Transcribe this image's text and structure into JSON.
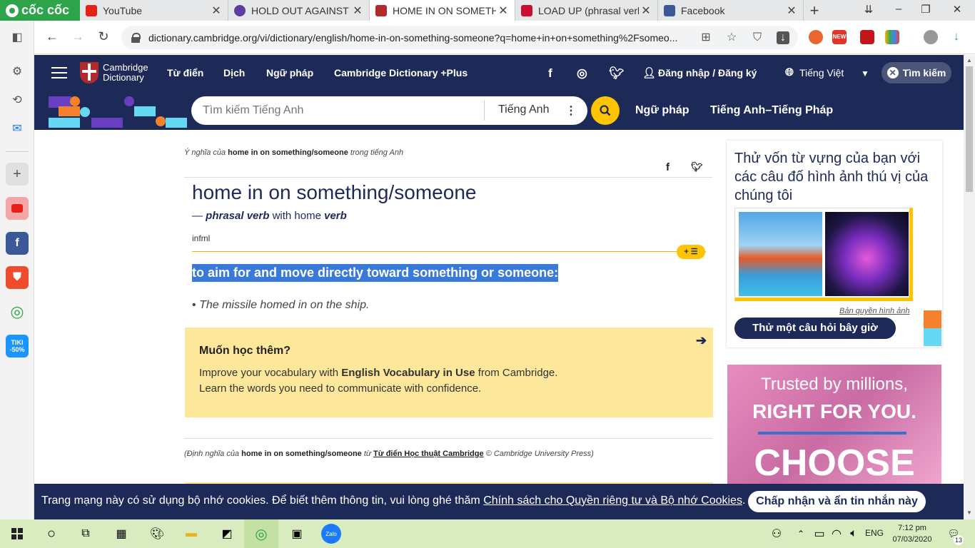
{
  "browser": {
    "brand": "cốc cốc",
    "tabs": [
      {
        "label": "YouTube",
        "color": "#e62117"
      },
      {
        "label": "HOLD OUT AGAINST - D",
        "color": "#5a3ea0"
      },
      {
        "label": "HOME IN ON SOMETHI",
        "color": "#b4292b"
      },
      {
        "label": "LOAD UP (phrasal verb)",
        "color": "#c8102e"
      },
      {
        "label": "Facebook",
        "color": "#3b5998"
      }
    ],
    "new_tab": "+",
    "url": "dictionary.cambridge.org/vi/dictionary/english/home-in-on-something-someone?q=home+in+on+something%2Fsomeo...",
    "ext_new_label": "NEW"
  },
  "header": {
    "logo_line1": "Cambridge",
    "logo_line2": "Dictionary",
    "nav": [
      "Từ điển",
      "Dịch",
      "Ngữ pháp",
      "Cambridge Dictionary +Plus"
    ],
    "login": "Đăng nhập / Đăng ký",
    "language": "Tiếng Việt",
    "search_btn": "Tìm kiếm"
  },
  "subheader": {
    "search_placeholder": "Tìm kiếm Tiếng Anh",
    "dict_select": "Tiếng Anh",
    "links": [
      "Ngữ pháp",
      "Tiếng Anh–Tiếng Pháp"
    ]
  },
  "entry": {
    "meaning_prefix": "Ý nghĩa của",
    "meaning_term": "home in on something/someone",
    "meaning_suffix": "trong tiếng Anh",
    "headword": "home in on something/someone",
    "pos_dash": "—",
    "pos": "phrasal verb",
    "pos_with": "with home",
    "pos_verb": "verb",
    "register": "infml",
    "definition": "to aim for and move directly toward something or someone:",
    "example_bullet": "•",
    "example": "The missile homed in on the ship.",
    "learn_title": "Muốn học thêm?",
    "learn_l1_a": "Improve your vocabulary with",
    "learn_l1_b": "English Vocabulary in Use",
    "learn_l1_c": "from Cambridge.",
    "learn_l2": "Learn the words you need to communicate with confidence.",
    "source_prefix": "(Định nghĩa của",
    "source_term": "home in on something/someone",
    "source_from": "từ",
    "source_link": "Từ điển Học thuật Cambridge",
    "source_suffix": "© Cambridge University Press)"
  },
  "quiz": {
    "title": "Thử vốn từ vựng của bạn với các câu đố hình ảnh thú vị của chúng tôi",
    "copyright": "Bản quyền hình ảnh",
    "button": "Thử một câu hỏi bây giờ"
  },
  "ad": {
    "line1": "Trusted by millions,",
    "line2": "RIGHT FOR YOU.",
    "line3": "CHOOSE"
  },
  "cookie": {
    "msg_a": "Trang mạng này có sử dụng bộ nhớ cookies. Để biết thêm thông tin, vui lòng ghé thăm",
    "msg_link": "Chính sách cho Quyền riêng tư và Bộ nhớ Cookies",
    "msg_end": ".",
    "accept": "Chấp nhận và ẩn tin nhắn này"
  },
  "taskbar": {
    "lang": "ENG",
    "time": "7:12 pm",
    "date": "07/03/2020",
    "notif_count": "13"
  },
  "sidebar_badge": {
    "tiki": "TIKI",
    "discount": "-50%"
  }
}
